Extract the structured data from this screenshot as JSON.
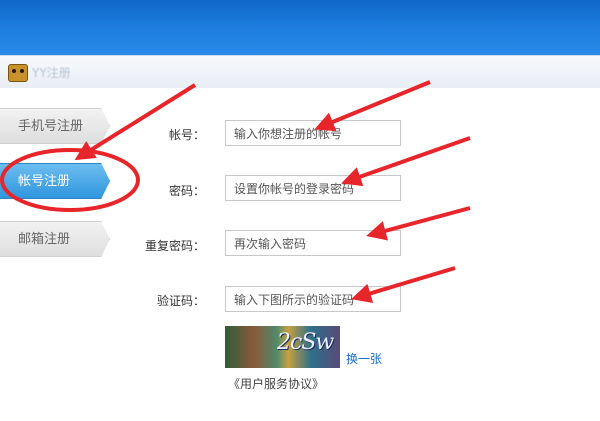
{
  "window": {
    "title": "YY注册"
  },
  "tabs": [
    {
      "label": "手机号注册",
      "active": false
    },
    {
      "label": "帐号注册",
      "active": true
    },
    {
      "label": "邮箱注册",
      "active": false
    }
  ],
  "form": {
    "account": {
      "label": "帐号：",
      "placeholder": "输入你想注册的帐号"
    },
    "password": {
      "label": "密码：",
      "placeholder": "设置你帐号的登录密码"
    },
    "confirm_password": {
      "label": "重复密码：",
      "placeholder": "再次输入密码"
    },
    "captcha": {
      "label": "验证码：",
      "placeholder": "输入下图所示的验证码",
      "image_text": "2cSw"
    },
    "refresh_label": "换一张",
    "agreement_label": "《用户服务协议》"
  },
  "colors": {
    "header_blue": "#1f7fe0",
    "active_tab": "#2f96dd",
    "annotation_red": "#e8252a",
    "link": "#1a6fd0"
  }
}
